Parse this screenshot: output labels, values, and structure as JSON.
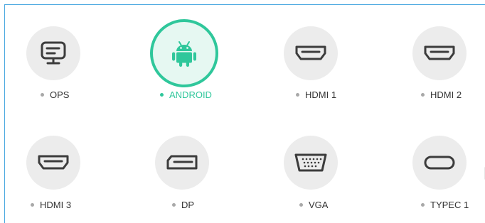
{
  "sources": [
    {
      "label": "OPS",
      "icon": "monitor-icon",
      "selected": false
    },
    {
      "label": "ANDROID",
      "icon": "android-icon",
      "selected": true
    },
    {
      "label": "HDMI 1",
      "icon": "hdmi-port-icon",
      "selected": false
    },
    {
      "label": "HDMI 2",
      "icon": "hdmi-port-icon",
      "selected": false
    },
    {
      "label": "HDMI 3",
      "icon": "hdmi-port-icon",
      "selected": false
    },
    {
      "label": "DP",
      "icon": "displayport-icon",
      "selected": false
    },
    {
      "label": "VGA",
      "icon": "vga-port-icon",
      "selected": false
    },
    {
      "label": "TYPEC 1",
      "icon": "usb-c-port-icon",
      "selected": false
    }
  ],
  "colors": {
    "accent": "#2fc79b",
    "circle_bg": "#ececec",
    "icon": "#3c3c3c",
    "dot": "#a8a8a8",
    "frame_border": "#4aa8e0"
  }
}
